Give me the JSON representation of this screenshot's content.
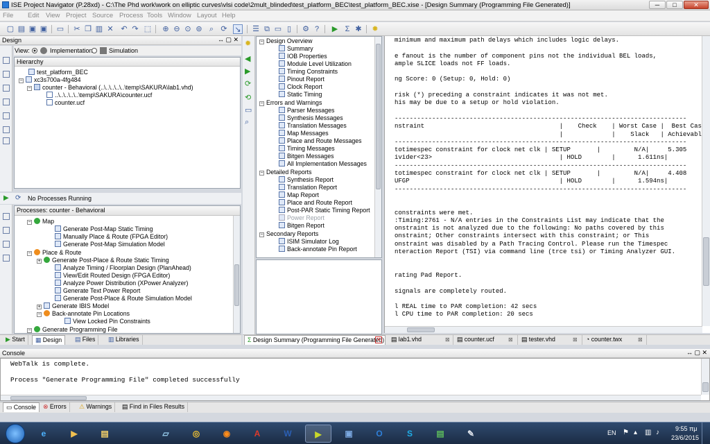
{
  "window": {
    "title": "ISE Project Navigator (P.28xd) - C:\\The Phd work\\work on elliptic curves\\vlsi code\\2mult_blinded\\test_platform_BEC\\test_platform_BEC.xise - [Design Summary (Programming File Generated)]",
    "min": "─",
    "max": "□",
    "close": "✕"
  },
  "menu": [
    "File",
    "Edit",
    "View",
    "Project",
    "Source",
    "Process",
    "Tools",
    "Window",
    "Layout",
    "Help"
  ],
  "design_panel": {
    "title": "Design",
    "view_label": "View:",
    "impl_label": "Implementation",
    "sim_label": "Simulation",
    "hierarchy_label": "Hierarchy",
    "tree": [
      "test_platform_BEC",
      "xc3s700a-4fg484",
      "counter - Behavioral (..\\..\\..\\..\\..\\temp\\SAKURA\\lab1.vhd)",
      "..\\..\\..\\..\\..\\temp\\SAKURA\\counter.ucf",
      "counter.ucf"
    ]
  },
  "processes_panel": {
    "status": "No Processes Running",
    "title": "Processes: counter - Behavioral",
    "items": [
      "Map",
      "Generate Post-Map Static Timing",
      "Manually Place & Route (FPGA Editor)",
      "Generate Post-Map Simulation Model",
      "Place & Route",
      "Generate Post-Place & Route Static Timing",
      "Analyze Timing / Floorplan Design (PlanAhead)",
      "View/Edit Routed Design (FPGA Editor)",
      "Analyze Power Distribution (XPower Analyzer)",
      "Generate Text Power Report",
      "Generate Post-Place & Route Simulation Model",
      "Generate IBIS Model",
      "Back-annotate Pin Locations",
      "View Locked Pin Constraints",
      "Generate Programming File"
    ]
  },
  "left_tabs": [
    "Start",
    "Design",
    "Files",
    "Libraries"
  ],
  "summary_nav": {
    "design_overview": "Design Overview",
    "overview_items": [
      "Summary",
      "IOB Properties",
      "Module Level Utilization",
      "Timing Constraints",
      "Pinout Report",
      "Clock Report",
      "Static Timing"
    ],
    "errors_warnings": "Errors and Warnings",
    "ew_items": [
      "Parser Messages",
      "Synthesis Messages",
      "Translation Messages",
      "Map Messages",
      "Place and Route Messages",
      "Timing Messages",
      "Bitgen Messages",
      "All Implementation Messages"
    ],
    "detailed_reports": "Detailed Reports",
    "dr_items": [
      "Synthesis Report",
      "Translation Report",
      "Map Report",
      "Place and Route Report",
      "Post-PAR Static Timing Report",
      "Power Report",
      "Bitgen Report"
    ],
    "secondary_reports": "Secondary Reports",
    "sr_items": [
      "ISIM Simulator Log",
      "Back-annotate Pin Report"
    ]
  },
  "report_lines": [
    "minimum and maximum path delays which includes logic delays.",
    "",
    "e fanout is the number of component pins not the individual BEL loads,",
    "ample SLICE loads not FF loads.",
    "",
    "ng Score: 0 (Setup: 0, Hold: 0)",
    "",
    "risk (*) preceding a constraint indicates it was not met.",
    "his may be due to a setup or hold violation.",
    "",
    "------------------------------------------------------------------------------",
    "nstraint                                    |    Check    | Worst Case |  Best Cas",
    "                                            |             |    Slack   | Achievabl",
    "------------------------------------------------------------------------------",
    "totimespec constraint for clock net clk | SETUP       |         N/A|     5.305",
    "ivider<23>                                  | HOLD        |      1.611ns|",
    "------------------------------------------------------------------------------",
    "totimespec constraint for clock net clk | SETUP       |         N/A|     4.408",
    "UFGP                                        | HOLD        |      1.594ns|",
    "------------------------------------------------------------------------------",
    "",
    "",
    "constraints were met.",
    ":Timing:2761 - N/A entries in the Constraints List may indicate that the",
    "onstraint is not analyzed due to the following: No paths covered by this",
    "onstraint; Other constraints intersect with this constraint; or This",
    "onstraint was disabled by a Path Tracing Control. Please run the Timespec",
    "nteraction Report (TSI) via command line (trce tsi) or Timing Analyzer GUI.",
    "",
    "",
    "rating Pad Report.",
    "",
    "signals are completely routed.",
    "",
    "l REAL time to PAR completion: 42 secs",
    "l CPU time to PAR completion: 20 secs"
  ],
  "doc_tabs": [
    "Design Summary (Programming File Generated)",
    "lab1.vhd",
    "counter.ucf",
    "tester.vhd",
    "counter.twx"
  ],
  "console": {
    "title": "Console",
    "lines": [
      "WebTalk is complete.",
      "",
      "Process \"Generate Programming File\" completed successfully"
    ]
  },
  "console_tabs": [
    "Console",
    "Errors",
    "Warnings",
    "Find in Files Results"
  ],
  "taskbar": {
    "lang": "EN",
    "time": "9:55 πμ",
    "date": "23/6/2015"
  }
}
